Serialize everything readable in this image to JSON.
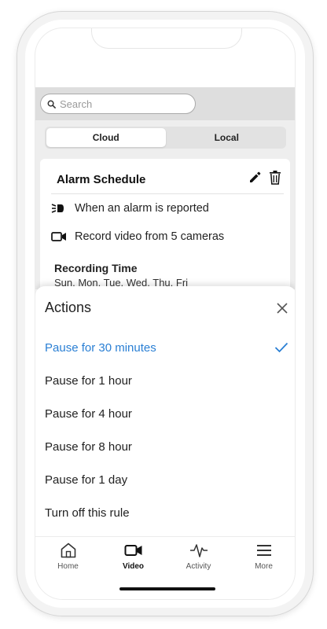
{
  "search": {
    "placeholder": "Search"
  },
  "segments": [
    {
      "label": "Cloud",
      "active": true
    },
    {
      "label": "Local",
      "active": false
    }
  ],
  "card": {
    "title": "Alarm Schedule",
    "trigger_text": "When an alarm is reported",
    "record_text": "Record video from 5 cameras",
    "recording_time_label": "Recording Time",
    "recording_days": "Sun, Mon, Tue, Wed, Thu, Fri"
  },
  "sheet": {
    "title": "Actions",
    "items": [
      {
        "label": "Pause for 30 minutes",
        "selected": true
      },
      {
        "label": "Pause for 1 hour",
        "selected": false
      },
      {
        "label": "Pause for 4 hour",
        "selected": false
      },
      {
        "label": "Pause for 8 hour",
        "selected": false
      },
      {
        "label": "Pause for 1 day",
        "selected": false
      },
      {
        "label": "Turn off this rule",
        "selected": false
      }
    ]
  },
  "tabs": [
    {
      "label": "Home",
      "icon": "home-icon",
      "active": false
    },
    {
      "label": "Video",
      "icon": "video-icon",
      "active": true
    },
    {
      "label": "Activity",
      "icon": "activity-icon",
      "active": false
    },
    {
      "label": "More",
      "icon": "menu-icon",
      "active": false
    }
  ],
  "colors": {
    "accent": "#2a7fd4",
    "background_gray": "#eeeeee"
  }
}
